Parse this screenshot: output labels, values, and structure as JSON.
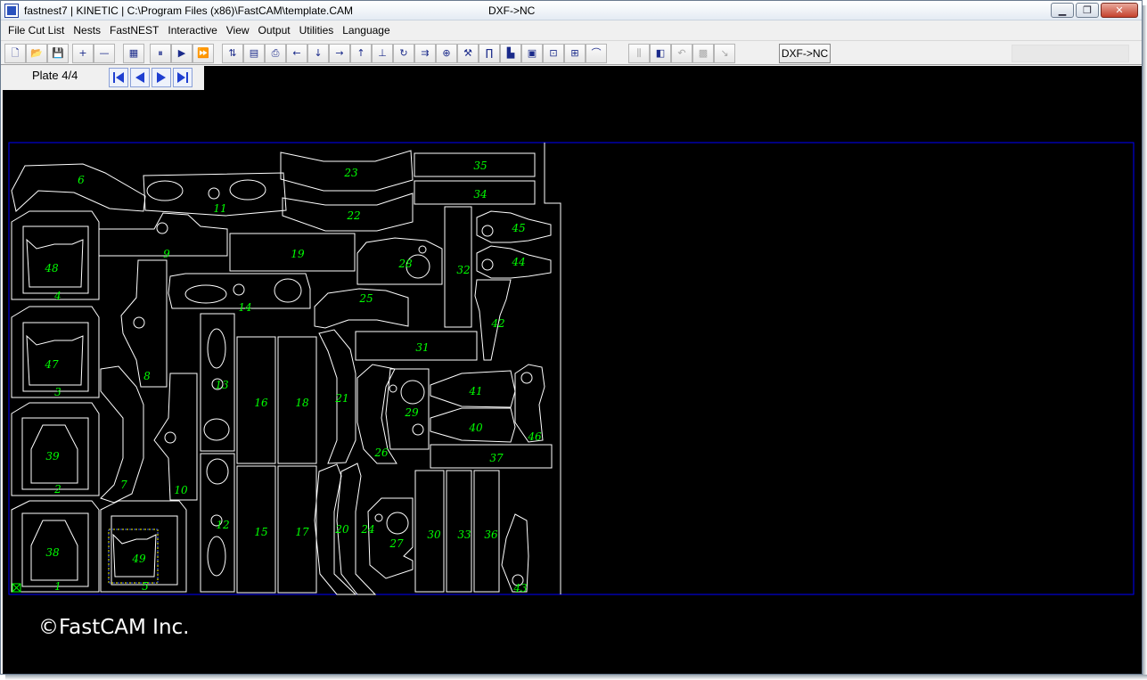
{
  "titlebar": {
    "title": "fastnest7  |  KINETIC  |  C:\\Program Files (x86)\\FastCAM\\template.CAM",
    "mode": "DXF->NC",
    "minimize": "▁",
    "maximize": "❐",
    "close": "✕"
  },
  "menu": [
    "File Cut List",
    "Nests",
    "FastNEST",
    "Interactive",
    "View",
    "Output",
    "Utilities",
    "Language"
  ],
  "toolbar": {
    "groups": [
      [
        {
          "icon": "new-file-icon",
          "glyph": "🗋"
        },
        {
          "icon": "open-folder-icon",
          "glyph": "📂"
        },
        {
          "icon": "save-icon",
          "glyph": "💾"
        }
      ],
      [
        {
          "icon": "add-part-icon",
          "glyph": "+"
        },
        {
          "icon": "remove-part-icon",
          "glyph": "—"
        }
      ],
      [
        {
          "icon": "grid-icon",
          "glyph": "▦"
        }
      ],
      [
        {
          "icon": "pause-icon",
          "glyph": "⏸"
        },
        {
          "icon": "play-icon",
          "glyph": "▶"
        },
        {
          "icon": "fast-forward-icon",
          "glyph": "⏩"
        }
      ],
      [
        {
          "icon": "sort-icon",
          "glyph": "⇅"
        },
        {
          "icon": "report-icon",
          "glyph": "▤"
        },
        {
          "icon": "print-icon",
          "glyph": "⎙"
        },
        {
          "icon": "move-left-icon",
          "glyph": "←"
        },
        {
          "icon": "move-down-icon",
          "glyph": "↓"
        },
        {
          "icon": "move-right-icon",
          "glyph": "→"
        },
        {
          "icon": "move-up-icon",
          "glyph": "↑"
        },
        {
          "icon": "align-icon",
          "glyph": "⊥"
        },
        {
          "icon": "rotate-icon",
          "glyph": "↻"
        },
        {
          "icon": "array-icon",
          "glyph": "⇉"
        },
        {
          "icon": "lead-icon",
          "glyph": "⊕"
        },
        {
          "icon": "wrench-icon",
          "glyph": "⚒"
        },
        {
          "icon": "bridge-icon",
          "glyph": "∏"
        },
        {
          "icon": "chart-icon",
          "glyph": "▙"
        },
        {
          "icon": "remnant-icon",
          "glyph": "▣"
        },
        {
          "icon": "zoom-icon",
          "glyph": "⊡"
        },
        {
          "icon": "zoom-all-icon",
          "glyph": "⊞"
        },
        {
          "icon": "path-icon",
          "glyph": "⌒"
        }
      ],
      [
        {
          "icon": "common-cut-icon",
          "glyph": "⫼",
          "disabled": true
        },
        {
          "icon": "layers-icon",
          "glyph": "◧"
        },
        {
          "icon": "undo-icon",
          "glyph": "↶",
          "disabled": true
        },
        {
          "icon": "plate-disabled-icon",
          "glyph": "▩",
          "disabled": true
        },
        {
          "icon": "nc-disabled-icon",
          "glyph": "↘",
          "disabled": true
        }
      ]
    ],
    "dxf_button": "DXF->NC"
  },
  "plate": {
    "label": "Plate 4/4",
    "nav": [
      "first-plate-icon",
      "prev-plate-icon",
      "next-plate-icon",
      "last-plate-icon"
    ]
  },
  "colors": {
    "background": "#000000",
    "part_outline": "#ffffff",
    "part_label": "#00ff00",
    "plate_border": "#0000ff",
    "selected": "#ffff00"
  },
  "parts": [
    "1",
    "2",
    "3",
    "4",
    "5",
    "6",
    "7",
    "8",
    "9",
    "10",
    "11",
    "12",
    "13",
    "14",
    "15",
    "16",
    "17",
    "18",
    "19",
    "20",
    "21",
    "22",
    "23",
    "24",
    "25",
    "26",
    "27",
    "28",
    "29",
    "30",
    "31",
    "32",
    "33",
    "34",
    "35",
    "36",
    "37",
    "38",
    "39",
    "40",
    "41",
    "42",
    "43",
    "44",
    "45",
    "46",
    "47",
    "48",
    "49"
  ],
  "selected_part": "49",
  "copyright": "©FastCAM Inc."
}
